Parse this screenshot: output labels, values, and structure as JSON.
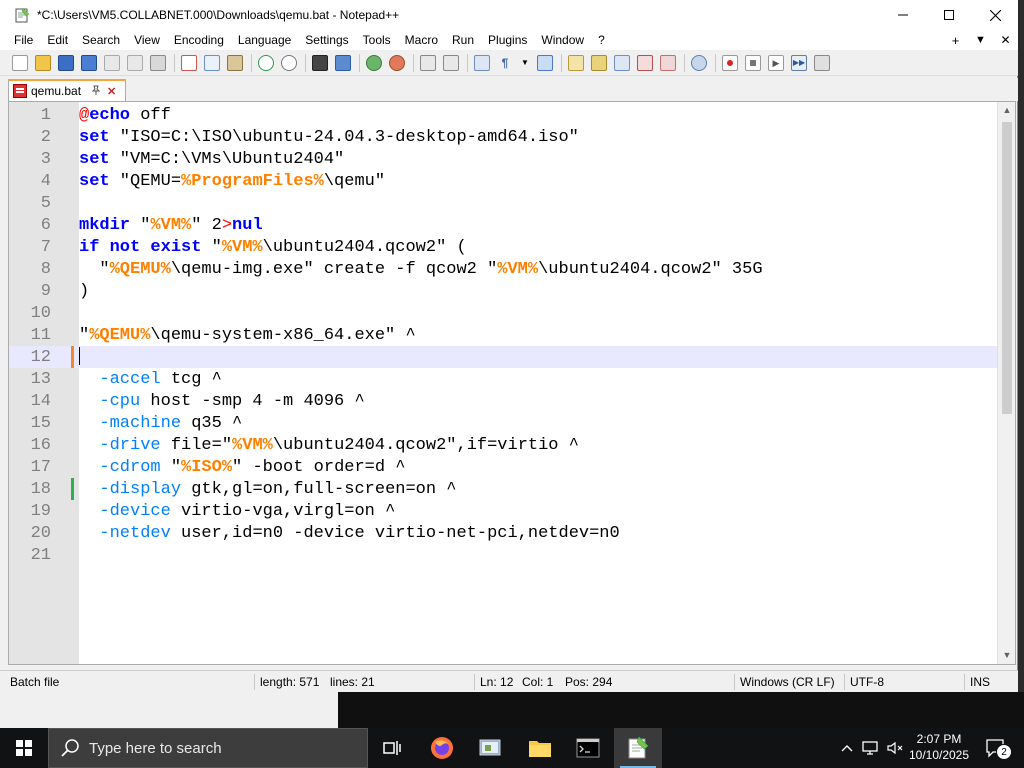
{
  "window": {
    "title": "*C:\\Users\\VM5.COLLABNET.000\\Downloads\\qemu.bat - Notepad++",
    "controls": {
      "minimize": "—",
      "maximize": "☐",
      "close": "✕"
    }
  },
  "menu": {
    "items": [
      "File",
      "Edit",
      "Search",
      "View",
      "Encoding",
      "Language",
      "Settings",
      "Tools",
      "Macro",
      "Run",
      "Plugins",
      "Window",
      "?"
    ],
    "right": {
      "add": "+",
      "dropdown": "▼",
      "close": "✕"
    }
  },
  "tab": {
    "label": "qemu.bat",
    "pin": "📌",
    "close": "✕"
  },
  "editor": {
    "line_numbers": [
      "1",
      "2",
      "3",
      "4",
      "5",
      "6",
      "7",
      "8",
      "9",
      "10",
      "11",
      "12",
      "13",
      "14",
      "15",
      "16",
      "17",
      "18",
      "19",
      "20",
      "21"
    ],
    "lines": [
      [
        {
          "t": "@",
          "c": "sym"
        },
        {
          "t": "echo",
          "c": "kw"
        },
        {
          "t": " off",
          "c": ""
        }
      ],
      [
        {
          "t": "set",
          "c": "kw"
        },
        {
          "t": " \"ISO=C:\\ISO\\ubuntu-24.04.3-desktop-amd64.iso\"",
          "c": ""
        }
      ],
      [
        {
          "t": "set",
          "c": "kw"
        },
        {
          "t": " \"VM=C:\\VMs\\Ubuntu2404\"",
          "c": ""
        }
      ],
      [
        {
          "t": "set",
          "c": "kw"
        },
        {
          "t": " \"QEMU=",
          "c": ""
        },
        {
          "t": "%ProgramFiles%",
          "c": "var"
        },
        {
          "t": "\\qemu\"",
          "c": ""
        }
      ],
      [],
      [
        {
          "t": "mkdir",
          "c": "kw"
        },
        {
          "t": " \"",
          "c": ""
        },
        {
          "t": "%VM%",
          "c": "var"
        },
        {
          "t": "\" 2",
          "c": ""
        },
        {
          "t": ">",
          "c": "sym"
        },
        {
          "t": "nul",
          "c": "kw"
        }
      ],
      [
        {
          "t": "if not exist",
          "c": "kw"
        },
        {
          "t": " \"",
          "c": ""
        },
        {
          "t": "%VM%",
          "c": "var"
        },
        {
          "t": "\\ubuntu2404.qcow2\" (",
          "c": ""
        }
      ],
      [
        {
          "t": "  \"",
          "c": ""
        },
        {
          "t": "%QEMU%",
          "c": "var"
        },
        {
          "t": "\\qemu-img.exe\" create -f qcow2 \"",
          "c": ""
        },
        {
          "t": "%VM%",
          "c": "var"
        },
        {
          "t": "\\ubuntu2404.qcow2\" 35G",
          "c": ""
        }
      ],
      [
        {
          "t": ")",
          "c": ""
        }
      ],
      [],
      [
        {
          "t": "\"",
          "c": ""
        },
        {
          "t": "%QEMU%",
          "c": "var"
        },
        {
          "t": "\\qemu-system-x86_64.exe\" ^",
          "c": ""
        }
      ],
      [],
      [
        {
          "t": "  ",
          "c": ""
        },
        {
          "t": "-accel",
          "c": "opt"
        },
        {
          "t": " tcg ^",
          "c": ""
        }
      ],
      [
        {
          "t": "  ",
          "c": ""
        },
        {
          "t": "-cpu",
          "c": "opt"
        },
        {
          "t": " host -smp 4 -m 4096 ^",
          "c": ""
        }
      ],
      [
        {
          "t": "  ",
          "c": ""
        },
        {
          "t": "-machine",
          "c": "opt"
        },
        {
          "t": " q35 ^",
          "c": ""
        }
      ],
      [
        {
          "t": "  ",
          "c": ""
        },
        {
          "t": "-drive",
          "c": "opt"
        },
        {
          "t": " file=\"",
          "c": ""
        },
        {
          "t": "%VM%",
          "c": "var"
        },
        {
          "t": "\\ubuntu2404.qcow2\",if=virtio ^",
          "c": ""
        }
      ],
      [
        {
          "t": "  ",
          "c": ""
        },
        {
          "t": "-cdrom",
          "c": "opt"
        },
        {
          "t": " \"",
          "c": ""
        },
        {
          "t": "%ISO%",
          "c": "var"
        },
        {
          "t": "\" -boot order=d ^",
          "c": ""
        }
      ],
      [
        {
          "t": "  ",
          "c": ""
        },
        {
          "t": "-display",
          "c": "opt"
        },
        {
          "t": " gtk,gl=on,full-screen=on ^",
          "c": ""
        }
      ],
      [
        {
          "t": "  ",
          "c": ""
        },
        {
          "t": "-device",
          "c": "opt"
        },
        {
          "t": " virtio-vga,virgl=on ^",
          "c": ""
        }
      ],
      [
        {
          "t": "  ",
          "c": ""
        },
        {
          "t": "-netdev",
          "c": "opt"
        },
        {
          "t": " user,id=n0 -device virtio-net-pci,netdev=n0",
          "c": ""
        }
      ],
      []
    ],
    "current_line": 12,
    "change_markers": {
      "12": "#f08a24",
      "18": "#2db14a"
    }
  },
  "scrollbar": {
    "up": "▲",
    "down": "▼"
  },
  "status": {
    "file_type": "Batch file",
    "length": "length: 571",
    "lines": "lines: 21",
    "ln": "Ln: 12",
    "col": "Col: 1",
    "pos": "Pos: 294",
    "eol": "Windows (CR LF)",
    "encoding": "UTF-8",
    "mode": "INS"
  },
  "taskbar": {
    "search_placeholder": "Type here to search",
    "time": "2:07 PM",
    "date": "10/10/2025",
    "notification_count": "2",
    "apps": [
      "task-view-icon",
      "firefox-icon",
      "control-panel-icon",
      "file-explorer-icon",
      "command-prompt-icon",
      "notepad-plus-plus-icon"
    ]
  },
  "colors": {
    "keyword": "#0000ff",
    "variable": "#ff8000",
    "symbol": "#ff0000",
    "option": "#0080ff",
    "current_line": "#e8e8ff",
    "tab_accent": "#f6a53a"
  }
}
